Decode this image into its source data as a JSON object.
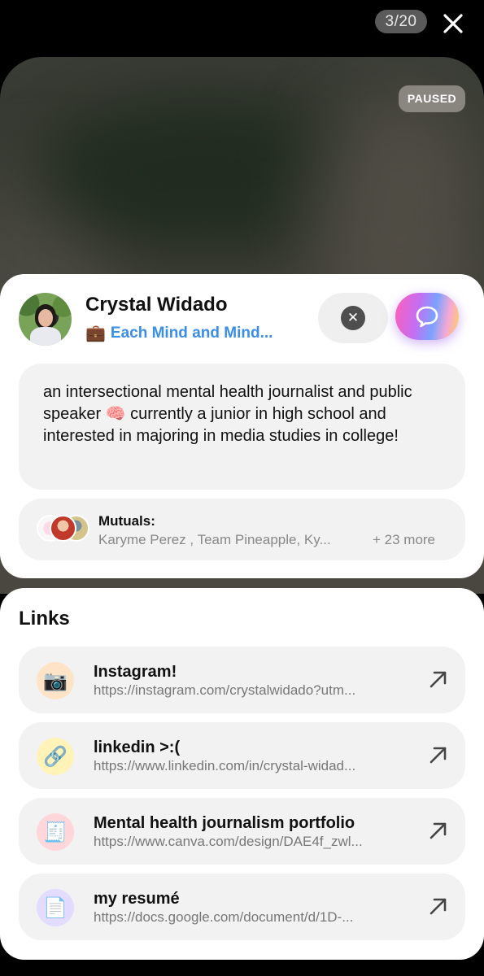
{
  "header": {
    "counter": "3/20",
    "close_icon": "close-icon"
  },
  "video": {
    "status_badge": "PAUSED"
  },
  "profile": {
    "name": "Crystal Widado",
    "org_icon": "💼",
    "org": "Each Mind and Mind...",
    "dismiss_icon": "x-circle-icon",
    "message_icon": "chat-bubble-icon",
    "bio": "an intersectional mental health journalist and public speaker 🧠 currently a junior in high school and interested in majoring in media studies in college!",
    "mutuals": {
      "title": "Mutuals:",
      "names": "Karyme Perez , Team Pineapple, Ky...",
      "more": "+ 23 more"
    }
  },
  "links": {
    "heading": "Links",
    "items": [
      {
        "title": "Instagram!",
        "url": "https://instagram.com/crystalwidado?utm...",
        "icon": "camera-icon",
        "glyph": "📷",
        "icon_bg": "#ffe3c7"
      },
      {
        "title": "linkedin >:(",
        "url": "https://www.linkedin.com/in/crystal-widad...",
        "icon": "link-icon",
        "glyph": "🔗",
        "icon_bg": "#fff3b8"
      },
      {
        "title": "Mental health journalism portfolio",
        "url": "https://www.canva.com/design/DAE4f_zwl...",
        "icon": "receipt-icon",
        "glyph": "🧾",
        "icon_bg": "#ffd6d9"
      },
      {
        "title": "my resumé",
        "url": "https://docs.google.com/document/d/1D-...",
        "icon": "document-icon",
        "glyph": "📄",
        "icon_bg": "#e3dcff"
      }
    ]
  },
  "colors": {
    "accent_blue": "#3a8ee6",
    "card_bg": "#ffffff",
    "row_bg": "#f2f2f2"
  }
}
